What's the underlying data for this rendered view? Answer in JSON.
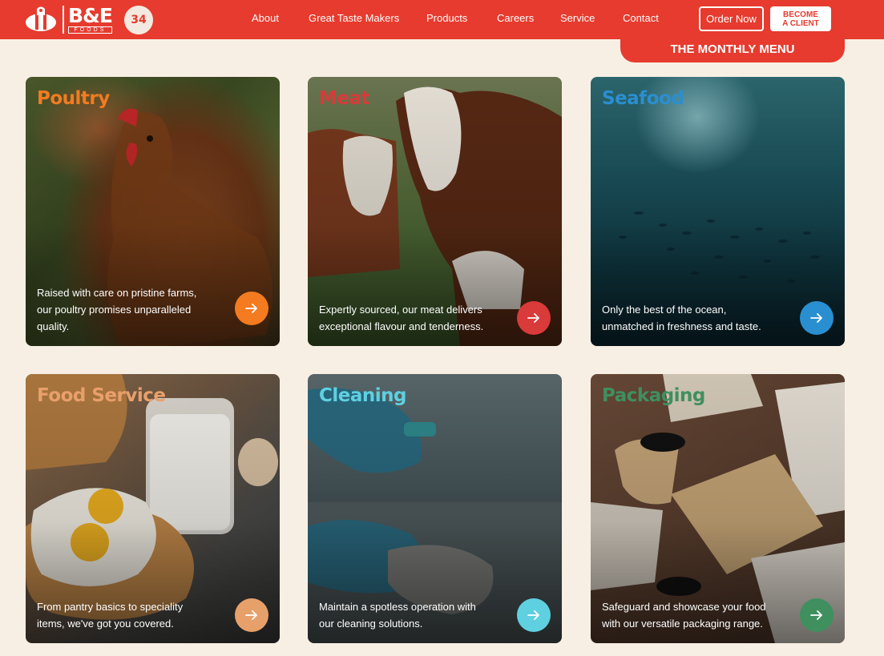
{
  "brand": {
    "name": "B&E",
    "sub": "FOODS",
    "badge": "34",
    "primary_color": "#e63b2e"
  },
  "nav": {
    "items": [
      {
        "label": "About"
      },
      {
        "label": "Great Taste Makers"
      },
      {
        "label": "Products"
      },
      {
        "label": "Careers"
      },
      {
        "label": "Service"
      },
      {
        "label": "Contact"
      }
    ]
  },
  "actions": {
    "order_now": "Order Now",
    "become_client_line1": "BECOME",
    "become_client_line2": "A CLIENT",
    "monthly_menu": "THE MONTHLY MENU"
  },
  "cards": [
    {
      "title": "Poultry",
      "title_color": "#f47b20",
      "desc_lines": [
        "Raised with care on pristine farms,",
        "our poultry promises unparalleled",
        "quality."
      ],
      "arrow_color": "#f47b20",
      "icon": "arrow-right-icon"
    },
    {
      "title": "Meat",
      "title_color": "#d93a3a",
      "desc_lines": [
        "Expertly sourced, our meat delivers",
        "exceptional flavour and tenderness."
      ],
      "arrow_color": "#d93a3a",
      "icon": "arrow-right-icon"
    },
    {
      "title": "Seafood",
      "title_color": "#2a8fd0",
      "desc_lines": [
        "Only the best of the ocean,",
        "unmatched in freshness and taste."
      ],
      "arrow_color": "#2a8fd0",
      "icon": "arrow-right-icon"
    },
    {
      "title": "Food Service",
      "title_color": "#e8a06b",
      "desc_lines": [
        "From pantry basics to speciality",
        "items, we've got you covered."
      ],
      "arrow_color": "#e8a06b",
      "icon": "arrow-right-icon"
    },
    {
      "title": "Cleaning",
      "title_color": "#5fd0e0",
      "desc_lines": [
        "Maintain a spotless operation with",
        "our cleaning solutions."
      ],
      "arrow_color": "#5fd0e0",
      "icon": "arrow-right-icon"
    },
    {
      "title": "Packaging",
      "title_color": "#3f8f5f",
      "desc_lines": [
        "Safeguard and showcase your food",
        "with our versatile packaging range."
      ],
      "arrow_color": "#3f8f5f",
      "icon": "arrow-right-icon"
    }
  ]
}
